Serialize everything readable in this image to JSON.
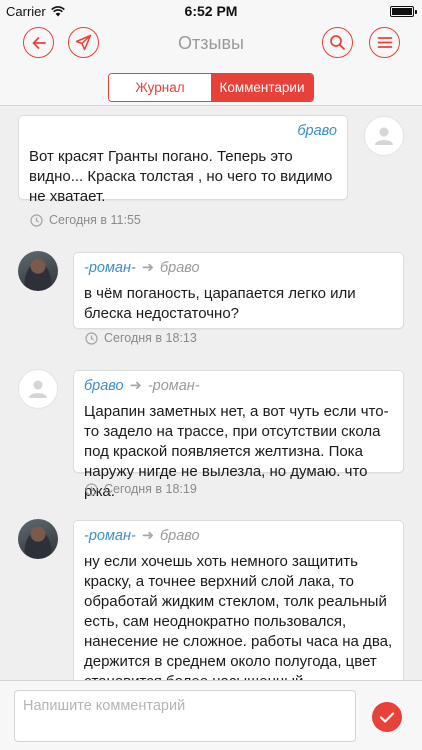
{
  "status_bar": {
    "carrier": "Carrier",
    "time": "6:52 PM"
  },
  "nav": {
    "title": "Отзывы",
    "segments": [
      {
        "label": "Журнал",
        "selected": false
      },
      {
        "label": "Комментарии",
        "selected": true
      }
    ],
    "icons": [
      "back-arrow-icon",
      "send-plane-icon",
      "search-icon",
      "menu-icon"
    ],
    "accent_color": "#e8413a"
  },
  "comments": [
    {
      "author": "браво",
      "recipient": "",
      "text": "Вот красят Гранты погано. Теперь это видно... Краска толстая , но чего то видимо не хватает.",
      "timestamp": "Сегодня в 11:55",
      "avatar": "placeholder"
    },
    {
      "author": "-роман-",
      "recipient": "браво",
      "text": "в чём поганость, царапается легко или блеска недостаточно?",
      "timestamp": "Сегодня в 18:13",
      "avatar": "photo"
    },
    {
      "author": "браво",
      "recipient": "-роман-",
      "text": "Царапин заметных нет, а вот чуть если что-то задело на трассе, при отсутствии скола под краской появляется желтизна. Пока наружу нигде не вылезла, но думаю. что ржа.",
      "timestamp": "Сегодня в 18:19",
      "avatar": "placeholder"
    },
    {
      "author": "-роман-",
      "recipient": "браво",
      "text": "ну если хочешь хоть немного защитить краску, а точнее верхний слой лака, то обработай жидким стеклом, толк реальный есть, сам неоднократно пользовался, нанесение не сложное. работы часа на два, держится в среднем около полугода, цвет становится более насыщенный, добавляется блеск и вода скатывается быстро и легко, я",
      "timestamp": "",
      "avatar": "photo"
    }
  ],
  "composer": {
    "placeholder": "Напишите комментарий",
    "value": ""
  },
  "colors": {
    "author_blue": "#3d8ec8",
    "recipient_grey": "#9a9a9a",
    "background": "#efefef"
  }
}
